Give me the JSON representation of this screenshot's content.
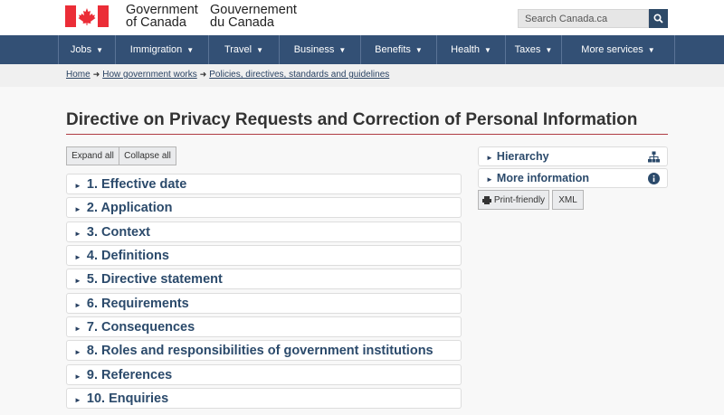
{
  "header": {
    "signature_en_line1": "Government",
    "signature_en_line2": "of Canada",
    "signature_fr_line1": "Gouvernement",
    "signature_fr_line2": "du Canada",
    "search_placeholder": "Search Canada.ca",
    "flag_icon": "canada-flag-icon",
    "search_icon": "magnifier-icon"
  },
  "menu": {
    "items": [
      {
        "label": "Jobs"
      },
      {
        "label": "Immigration"
      },
      {
        "label": "Travel"
      },
      {
        "label": "Business"
      },
      {
        "label": "Benefits"
      },
      {
        "label": "Health"
      },
      {
        "label": "Taxes"
      },
      {
        "label": "More services"
      }
    ]
  },
  "breadcrumb": {
    "items": [
      "Home",
      "How government works",
      "Policies, directives, standards and guidelines"
    ]
  },
  "page": {
    "title": "Directive on Privacy Requests and Correction of Personal Information",
    "expand_all": "Expand all",
    "collapse_all": "Collapse all"
  },
  "sections": [
    {
      "label": "1. Effective date"
    },
    {
      "label": "2. Application"
    },
    {
      "label": "3. Context"
    },
    {
      "label": "4. Definitions"
    },
    {
      "label": "5. Directive statement"
    },
    {
      "label": "6. Requirements"
    },
    {
      "label": "7. Consequences"
    },
    {
      "label": "8. Roles and responsibilities of government institutions"
    },
    {
      "label": "9. References"
    },
    {
      "label": "10. Enquiries"
    }
  ],
  "sidebar": {
    "hierarchy": "Hierarchy",
    "more_info": "More information",
    "print": "Print-friendly",
    "xml": "XML"
  },
  "colors": {
    "menu_bg": "#335075",
    "title_rule": "#af3c43",
    "link": "#284162",
    "flag_red": "#eb2d37"
  }
}
